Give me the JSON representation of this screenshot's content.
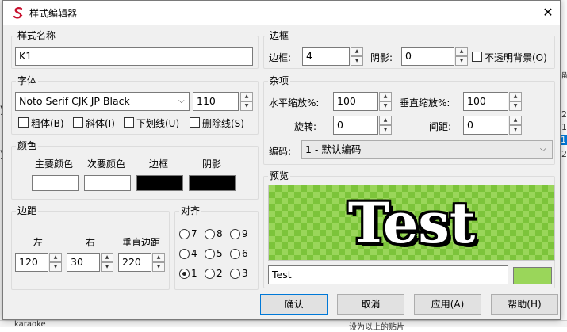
{
  "window": {
    "title": "样式编辑器",
    "close_glyph": "✕"
  },
  "style_name": {
    "label": "样式名称",
    "value": "K1"
  },
  "font": {
    "label": "字体",
    "family": "Noto Serif CJK JP Black",
    "size": "110",
    "bold": "粗体(B)",
    "italic": "斜体(I)",
    "underline": "下划线(U)",
    "strikeout": "删除线(S)"
  },
  "colors": {
    "label": "颜色",
    "primary": "主要颜色",
    "primary_color": "#ffffff",
    "secondary": "次要颜色",
    "secondary_color": "#ffffff",
    "outline": "边框",
    "outline_color": "#000000",
    "shadow": "阴影",
    "shadow_color": "#000000"
  },
  "margins": {
    "label": "边距",
    "left_label": "左",
    "left": "120",
    "right_label": "右",
    "right": "30",
    "vertical_label": "垂直边距",
    "vertical": "220"
  },
  "alignment": {
    "label": "对齐",
    "options": [
      "7",
      "8",
      "9",
      "4",
      "5",
      "6",
      "1",
      "2",
      "3"
    ],
    "selected": "1"
  },
  "border": {
    "label": "边框",
    "outline_label": "边框:",
    "outline": "4",
    "shadow_label": "阴影:",
    "shadow": "0",
    "opaque_box": "不透明背景(O)"
  },
  "misc": {
    "label": "杂项",
    "scale_x_label": "水平缩放%:",
    "scale_x": "100",
    "scale_y_label": "垂直缩放%:",
    "scale_y": "100",
    "rotation_label": "旋转:",
    "rotation": "0",
    "spacing_label": "间距:",
    "spacing": "0",
    "encoding_label": "编码:",
    "encoding": "1 - 默认编码"
  },
  "preview": {
    "label": "预览",
    "sample_text": "Test",
    "input_value": "Test",
    "bg_color": "#9ad65a"
  },
  "buttons": {
    "ok": "确认",
    "cancel": "取消",
    "apply": "应用(A)",
    "help": "帮助(H)"
  },
  "background": {
    "left_chars": [
      "y",
      "y"
    ],
    "right_chars": [
      "副",
      "2-",
      "1-",
      "1",
      "2"
    ],
    "bottom_left": "karaoke",
    "bottom_mid": "设为以上的贴片"
  }
}
